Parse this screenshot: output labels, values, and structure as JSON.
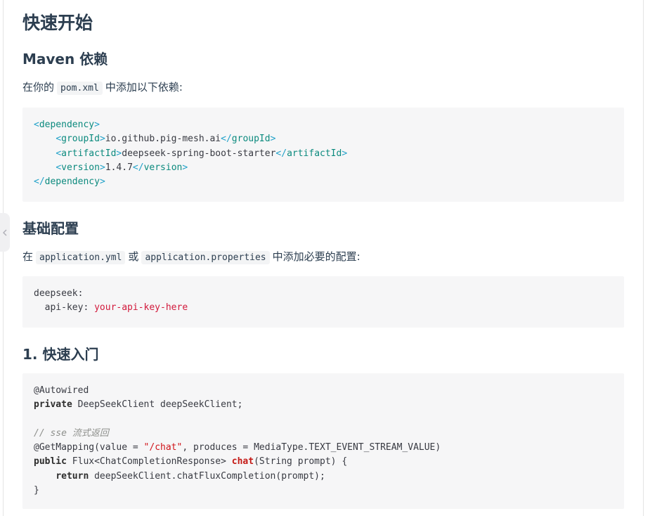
{
  "page": {
    "title": "快速开始",
    "maven_section": {
      "heading": "Maven 依赖",
      "intro_prefix": "在你的",
      "intro_code": "pom.xml",
      "intro_suffix": "中添加以下依赖:",
      "code": {
        "open_tag": "dependency",
        "group_tag": "groupId",
        "group_value": "io.github.pig-mesh.ai",
        "artifact_tag": "artifactId",
        "artifact_value": "deepseek-spring-boot-starter",
        "version_tag": "version",
        "version_value": "1.4.7"
      }
    },
    "config_section": {
      "heading": "基础配置",
      "intro_prefix": "在",
      "intro_code1": "application.yml",
      "intro_or": "或",
      "intro_code2": "application.properties",
      "intro_suffix": "中添加必要的配置:",
      "code": {
        "line1": "deepseek:",
        "key": "  api-key: ",
        "value": "your-api-key-here"
      }
    },
    "quick_section": {
      "heading": "1. 快速入门",
      "code": {
        "annotation": "@Autowired",
        "private_kw": "private",
        "field_decl": " DeepSeekClient deepSeekClient;",
        "comment": "// sse 流式返回",
        "mapping_prefix": "@GetMapping(value = ",
        "mapping_path": "\"/chat\"",
        "mapping_suffix": ", produces = MediaType.TEXT_EVENT_STREAM_VALUE)",
        "public_kw": "public",
        "return_type": " Flux<ChatCompletionResponse> ",
        "method_name": "chat",
        "method_params": "(String prompt) {",
        "indent": "    ",
        "return_kw": "return",
        "return_expr": " deepSeekClient.chatFluxCompletion(prompt);",
        "close_brace": "}"
      }
    }
  },
  "sidebar_toggle": {
    "icon": "chevron-left-icon"
  },
  "colors": {
    "text": "#2c3e50",
    "code_bg": "#f6f6f7",
    "xml_tag": "#0c8a7e",
    "string": "#d0141a",
    "comment": "#8e908c"
  }
}
